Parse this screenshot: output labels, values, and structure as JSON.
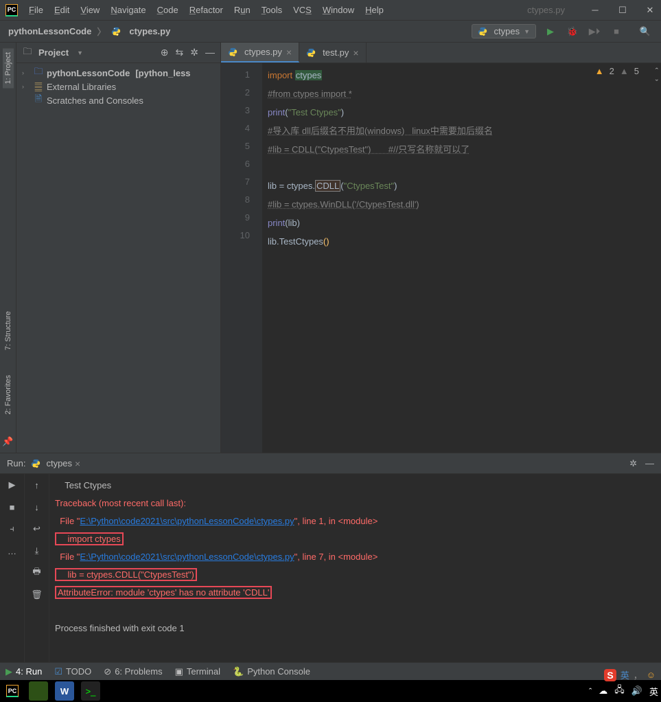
{
  "app": {
    "logo_text": "PC",
    "title_file": "ctypes.py"
  },
  "menu": {
    "file": "File",
    "edit": "Edit",
    "view": "View",
    "navigate": "Navigate",
    "code": "Code",
    "refactor": "Refactor",
    "run": "Run",
    "tools": "Tools",
    "vcs": "VCS",
    "window": "Window",
    "help": "Help"
  },
  "breadcrumb": {
    "root": "pythonLessonCode",
    "file": "ctypes.py"
  },
  "run_config": {
    "selected": "ctypes"
  },
  "project_panel": {
    "title": "Project",
    "root": "pythonLessonCode",
    "root_suffix": "[python_less",
    "external": "External Libraries",
    "scratches": "Scratches and Consoles"
  },
  "tabs": {
    "active": "ctypes.py",
    "other": "test.py"
  },
  "editor": {
    "warnings": {
      "yellow": "2",
      "grey": "5"
    },
    "lines": [
      "1",
      "2",
      "3",
      "4",
      "5",
      "6",
      "7",
      "8",
      "9",
      "10"
    ],
    "l1": {
      "kw": "import ",
      "mod": "ctypes"
    },
    "l2": "#from ctypes import *",
    "l3": {
      "fn": "print",
      "open": "(",
      "str": "\"Test Ctypes\"",
      "close": ")"
    },
    "l4": "#导入库 dll后缀名不用加(windows)   linux中需要加后缀名",
    "l5": "#lib = CDLL(\"CtypesTest\")       #//只写名称就可以了",
    "l7": {
      "a": "lib = ctypes.",
      "b": "CDLL",
      "c": "(",
      "d": "\"CtypesTest\"",
      "e": ")"
    },
    "l8": "#lib = ctypes.WinDLL('/CtypesTest.dll')",
    "l9": {
      "fn": "print",
      "open": "(",
      "arg": "lib",
      "close": ")"
    },
    "l10": {
      "a": "lib.TestCtypes",
      "b": "()"
    }
  },
  "run_panel": {
    "label": "Run:",
    "tab": "ctypes",
    "out0": "    Test Ctypes",
    "out1": "Traceback (most recent call last):",
    "out2a": "  File \"",
    "out2b": "E:\\Python\\code2021\\src\\pythonLessonCode\\ctypes.py",
    "out2c": "\", line 1, in <module>",
    "out3": "    import ctypes",
    "out4a": "  File \"",
    "out4b": "E:\\Python\\code2021\\src\\pythonLessonCode\\ctypes.py",
    "out4c": "\", line 7, in <module>",
    "out5": "    lib = ctypes.CDLL(\"CtypesTest\")",
    "out6": "AttributeError: module 'ctypes' has no attribute 'CDLL'",
    "blank": "",
    "exit": "Process finished with exit code 1"
  },
  "bottom": {
    "run": "4: Run",
    "todo": "TODO",
    "problems": "6: Problems",
    "terminal": "Terminal",
    "pyconsole": "Python Console"
  },
  "left_tabs": {
    "project": "1: Project",
    "structure": "7: Structure",
    "favorites": "2: Favorites"
  },
  "ime": {
    "badge": "S",
    "lang": "英"
  }
}
